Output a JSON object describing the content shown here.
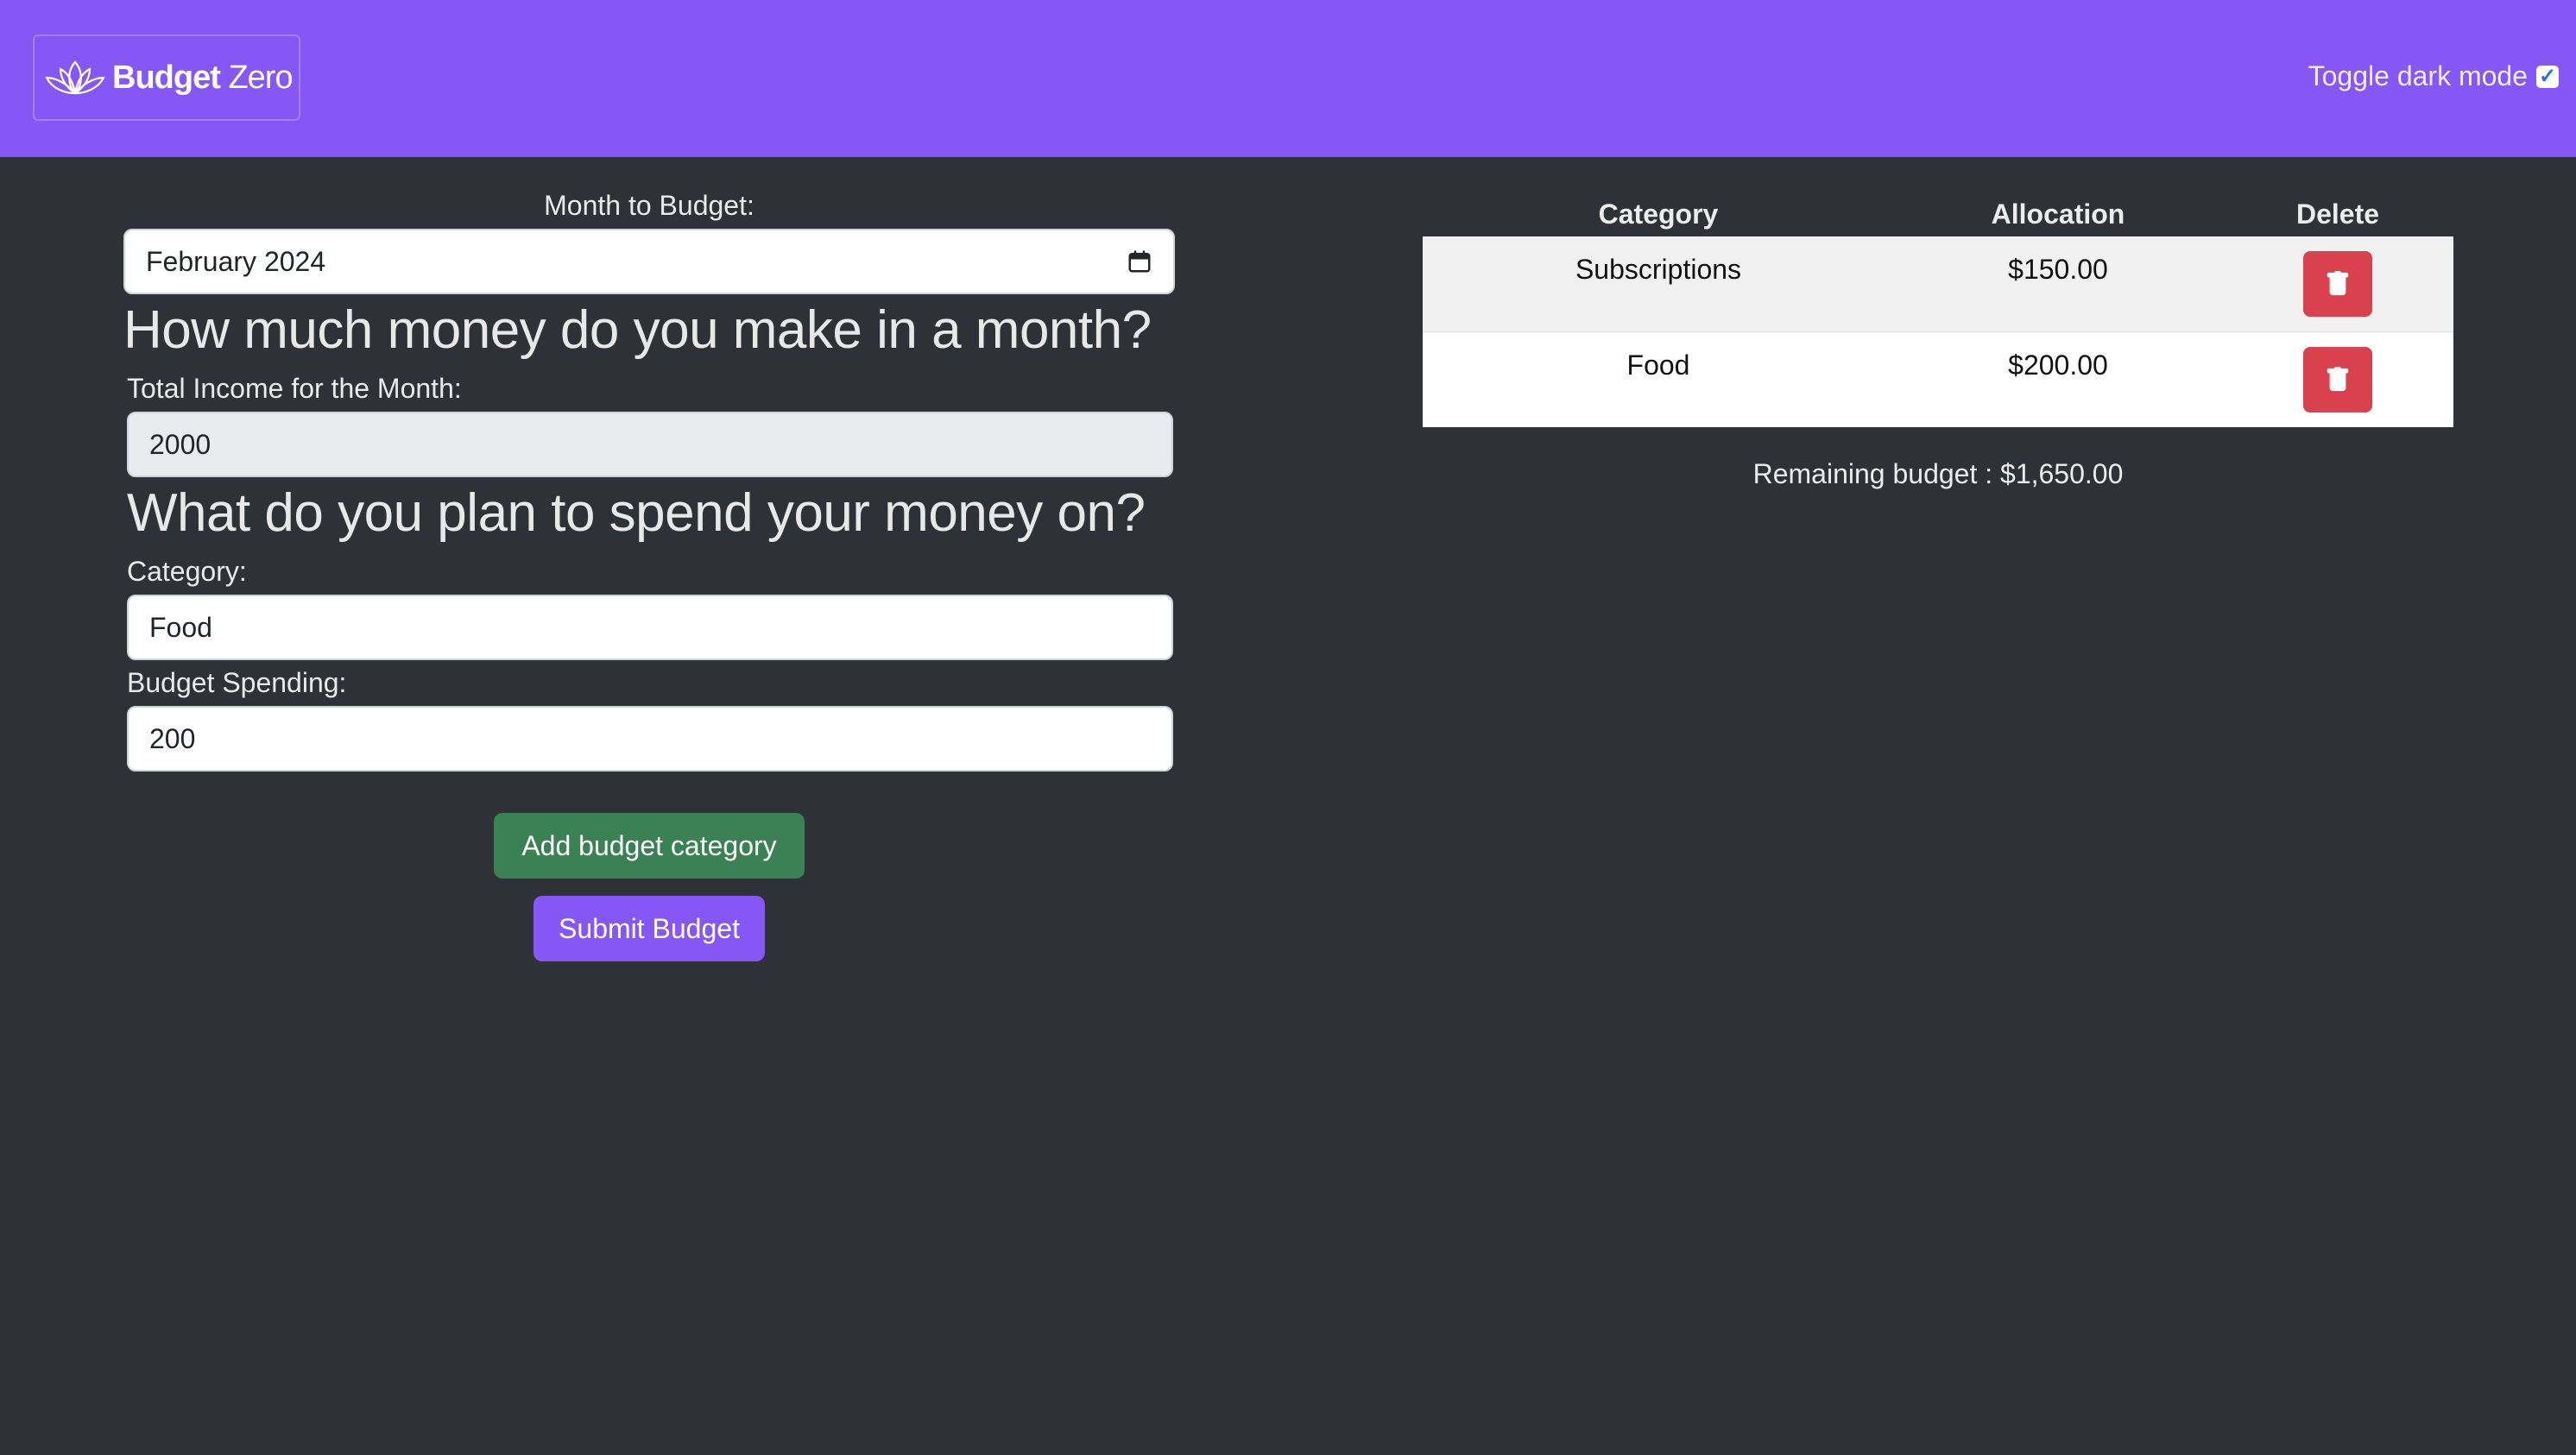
{
  "header": {
    "brand_bold": "Budget",
    "brand_light": "Zero",
    "dark_mode_label": "Toggle dark mode",
    "dark_mode_checked": true
  },
  "form": {
    "month_label": "Month to Budget:",
    "month_value": "February 2024",
    "income_question": "How much money do you make in a month?",
    "income_label": "Total Income for the Month:",
    "income_value": "2000",
    "spend_question": "What do you plan to spend your money on?",
    "category_label": "Category:",
    "category_value": "Food",
    "spending_label": "Budget Spending:",
    "spending_value": "200",
    "add_button": "Add budget category",
    "submit_button": "Submit Budget"
  },
  "table": {
    "headers": [
      "Category",
      "Allocation",
      "Delete"
    ],
    "rows": [
      {
        "category": "Subscriptions",
        "allocation": "$150.00"
      },
      {
        "category": "Food",
        "allocation": "$200.00"
      }
    ],
    "remaining": "Remaining budget : $1,650.00"
  },
  "colors": {
    "navbar": "#8757f5",
    "background": "#2e3236",
    "add_button": "#3a8254",
    "submit_button": "#8757f5",
    "delete_button": "#d9414e"
  },
  "icons": [
    "lotus-logo-icon",
    "calendar-icon",
    "trash-icon",
    "check-icon"
  ]
}
